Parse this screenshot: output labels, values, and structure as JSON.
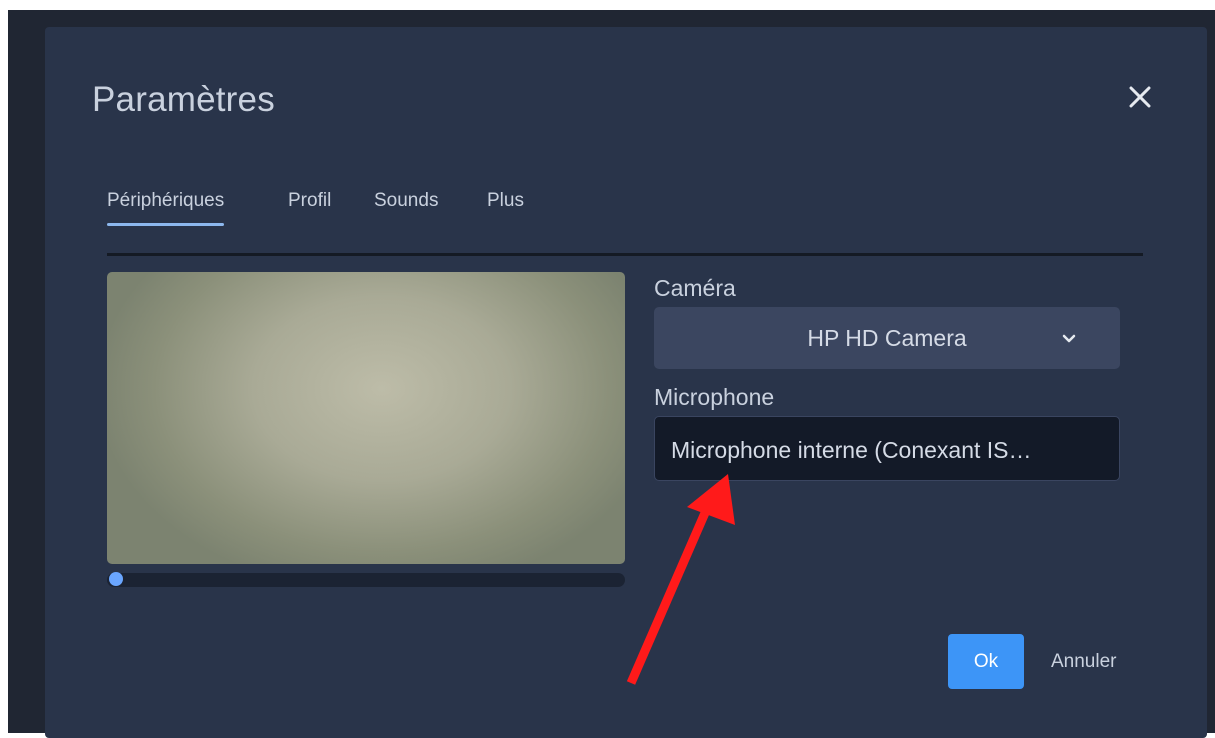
{
  "dialog": {
    "title": "Paramètres",
    "close_icon": "close-icon"
  },
  "tabs": [
    {
      "label": "Périphériques",
      "active": true
    },
    {
      "label": "Profil",
      "active": false
    },
    {
      "label": "Sounds",
      "active": false
    },
    {
      "label": "Plus",
      "active": false
    }
  ],
  "devices": {
    "camera_label": "Caméra",
    "camera_value": "HP HD Camera",
    "camera_icon": "chevron-down-icon",
    "microphone_label": "Microphone",
    "microphone_value": "Microphone interne (Conexant IS…"
  },
  "level_meter": {
    "level": 0.0
  },
  "footer": {
    "ok_label": "Ok",
    "cancel_label": "Annuler"
  },
  "colors": {
    "dialog_bg": "#29344a",
    "accent": "#3d95f7",
    "tab_indicator": "#8db8ee",
    "annotation_arrow": "#ff1a1a"
  }
}
